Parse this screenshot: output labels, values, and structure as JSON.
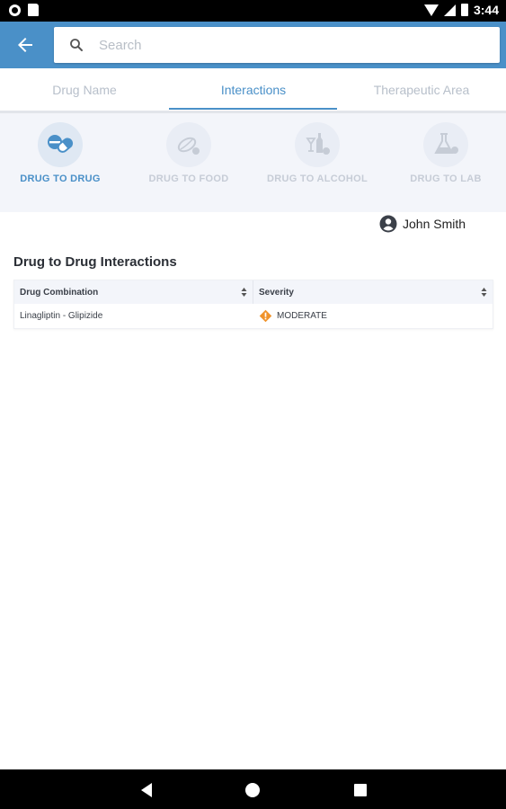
{
  "status_bar": {
    "time": "3:44",
    "icons": [
      "circle-notification-icon",
      "sd-card-icon",
      "wifi-icon",
      "signal-icon",
      "battery-icon"
    ]
  },
  "app_bar": {
    "back_icon": "arrow-left-icon",
    "search": {
      "placeholder": "Search",
      "value": ""
    },
    "color": "#4a90c8"
  },
  "tabs": [
    {
      "label": "Drug Name",
      "active": false
    },
    {
      "label": "Interactions",
      "active": true
    },
    {
      "label": "Therapeutic Area",
      "active": false
    }
  ],
  "categories": [
    {
      "label": "DRUG TO DRUG",
      "icon": "pills-icon",
      "active": true
    },
    {
      "label": "DRUG TO FOOD",
      "icon": "food-icon",
      "active": false
    },
    {
      "label": "DRUG TO ALCOHOL",
      "icon": "alcohol-icon",
      "active": false
    },
    {
      "label": "DRUG TO LAB",
      "icon": "lab-flask-icon",
      "active": false
    }
  ],
  "user": {
    "name": "John Smith",
    "icon": "account-circle-icon"
  },
  "section": {
    "title": "Drug to Drug Interactions"
  },
  "table": {
    "headers": [
      "Drug Combination",
      "Severity"
    ],
    "rows": [
      {
        "combination": "Linagliptin - Glipizide",
        "severity": "MODERATE",
        "severity_color": "#f0932b"
      }
    ]
  },
  "nav_bar": {
    "icons": [
      "back-triangle-icon",
      "home-circle-icon",
      "recents-square-icon"
    ]
  }
}
